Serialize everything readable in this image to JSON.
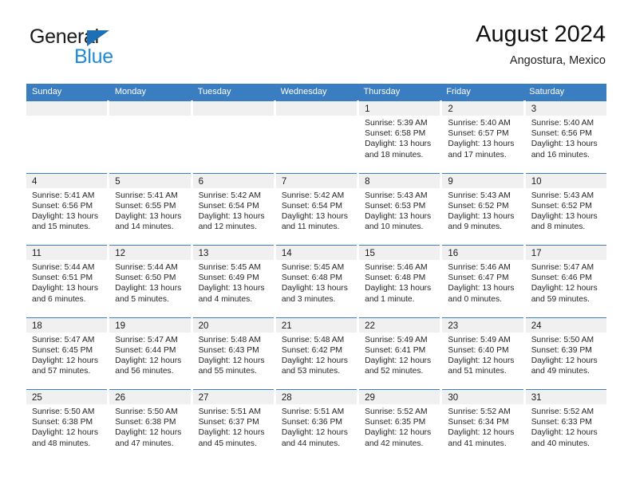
{
  "brand": {
    "name_part1": "General",
    "name_part2": "Blue",
    "triangle_color": "#1f6fb5",
    "blue_text_color": "#1f8ada"
  },
  "header": {
    "title": "August 2024",
    "subtitle": "Angostura, Mexico",
    "header_bg_color": "#3a7dc0",
    "daynum_band_color": "#f0f0f0"
  },
  "weekdays": [
    "Sunday",
    "Monday",
    "Tuesday",
    "Wednesday",
    "Thursday",
    "Friday",
    "Saturday"
  ],
  "labels": {
    "sunrise_prefix": "Sunrise:",
    "sunset_prefix": "Sunset:",
    "daylight_prefix": "Daylight:"
  },
  "weeks": [
    [
      {
        "empty": true
      },
      {
        "empty": true
      },
      {
        "empty": true
      },
      {
        "empty": true
      },
      {
        "day": "1",
        "sunrise": "Sunrise: 5:39 AM",
        "sunset": "Sunset: 6:58 PM",
        "daylight_line1": "Daylight: 13 hours",
        "daylight_line2": "and 18 minutes."
      },
      {
        "day": "2",
        "sunrise": "Sunrise: 5:40 AM",
        "sunset": "Sunset: 6:57 PM",
        "daylight_line1": "Daylight: 13 hours",
        "daylight_line2": "and 17 minutes."
      },
      {
        "day": "3",
        "sunrise": "Sunrise: 5:40 AM",
        "sunset": "Sunset: 6:56 PM",
        "daylight_line1": "Daylight: 13 hours",
        "daylight_line2": "and 16 minutes."
      }
    ],
    [
      {
        "day": "4",
        "sunrise": "Sunrise: 5:41 AM",
        "sunset": "Sunset: 6:56 PM",
        "daylight_line1": "Daylight: 13 hours",
        "daylight_line2": "and 15 minutes."
      },
      {
        "day": "5",
        "sunrise": "Sunrise: 5:41 AM",
        "sunset": "Sunset: 6:55 PM",
        "daylight_line1": "Daylight: 13 hours",
        "daylight_line2": "and 14 minutes."
      },
      {
        "day": "6",
        "sunrise": "Sunrise: 5:42 AM",
        "sunset": "Sunset: 6:54 PM",
        "daylight_line1": "Daylight: 13 hours",
        "daylight_line2": "and 12 minutes."
      },
      {
        "day": "7",
        "sunrise": "Sunrise: 5:42 AM",
        "sunset": "Sunset: 6:54 PM",
        "daylight_line1": "Daylight: 13 hours",
        "daylight_line2": "and 11 minutes."
      },
      {
        "day": "8",
        "sunrise": "Sunrise: 5:43 AM",
        "sunset": "Sunset: 6:53 PM",
        "daylight_line1": "Daylight: 13 hours",
        "daylight_line2": "and 10 minutes."
      },
      {
        "day": "9",
        "sunrise": "Sunrise: 5:43 AM",
        "sunset": "Sunset: 6:52 PM",
        "daylight_line1": "Daylight: 13 hours",
        "daylight_line2": "and 9 minutes."
      },
      {
        "day": "10",
        "sunrise": "Sunrise: 5:43 AM",
        "sunset": "Sunset: 6:52 PM",
        "daylight_line1": "Daylight: 13 hours",
        "daylight_line2": "and 8 minutes."
      }
    ],
    [
      {
        "day": "11",
        "sunrise": "Sunrise: 5:44 AM",
        "sunset": "Sunset: 6:51 PM",
        "daylight_line1": "Daylight: 13 hours",
        "daylight_line2": "and 6 minutes."
      },
      {
        "day": "12",
        "sunrise": "Sunrise: 5:44 AM",
        "sunset": "Sunset: 6:50 PM",
        "daylight_line1": "Daylight: 13 hours",
        "daylight_line2": "and 5 minutes."
      },
      {
        "day": "13",
        "sunrise": "Sunrise: 5:45 AM",
        "sunset": "Sunset: 6:49 PM",
        "daylight_line1": "Daylight: 13 hours",
        "daylight_line2": "and 4 minutes."
      },
      {
        "day": "14",
        "sunrise": "Sunrise: 5:45 AM",
        "sunset": "Sunset: 6:48 PM",
        "daylight_line1": "Daylight: 13 hours",
        "daylight_line2": "and 3 minutes."
      },
      {
        "day": "15",
        "sunrise": "Sunrise: 5:46 AM",
        "sunset": "Sunset: 6:48 PM",
        "daylight_line1": "Daylight: 13 hours",
        "daylight_line2": "and 1 minute."
      },
      {
        "day": "16",
        "sunrise": "Sunrise: 5:46 AM",
        "sunset": "Sunset: 6:47 PM",
        "daylight_line1": "Daylight: 13 hours",
        "daylight_line2": "and 0 minutes."
      },
      {
        "day": "17",
        "sunrise": "Sunrise: 5:47 AM",
        "sunset": "Sunset: 6:46 PM",
        "daylight_line1": "Daylight: 12 hours",
        "daylight_line2": "and 59 minutes."
      }
    ],
    [
      {
        "day": "18",
        "sunrise": "Sunrise: 5:47 AM",
        "sunset": "Sunset: 6:45 PM",
        "daylight_line1": "Daylight: 12 hours",
        "daylight_line2": "and 57 minutes."
      },
      {
        "day": "19",
        "sunrise": "Sunrise: 5:47 AM",
        "sunset": "Sunset: 6:44 PM",
        "daylight_line1": "Daylight: 12 hours",
        "daylight_line2": "and 56 minutes."
      },
      {
        "day": "20",
        "sunrise": "Sunrise: 5:48 AM",
        "sunset": "Sunset: 6:43 PM",
        "daylight_line1": "Daylight: 12 hours",
        "daylight_line2": "and 55 minutes."
      },
      {
        "day": "21",
        "sunrise": "Sunrise: 5:48 AM",
        "sunset": "Sunset: 6:42 PM",
        "daylight_line1": "Daylight: 12 hours",
        "daylight_line2": "and 53 minutes."
      },
      {
        "day": "22",
        "sunrise": "Sunrise: 5:49 AM",
        "sunset": "Sunset: 6:41 PM",
        "daylight_line1": "Daylight: 12 hours",
        "daylight_line2": "and 52 minutes."
      },
      {
        "day": "23",
        "sunrise": "Sunrise: 5:49 AM",
        "sunset": "Sunset: 6:40 PM",
        "daylight_line1": "Daylight: 12 hours",
        "daylight_line2": "and 51 minutes."
      },
      {
        "day": "24",
        "sunrise": "Sunrise: 5:50 AM",
        "sunset": "Sunset: 6:39 PM",
        "daylight_line1": "Daylight: 12 hours",
        "daylight_line2": "and 49 minutes."
      }
    ],
    [
      {
        "day": "25",
        "sunrise": "Sunrise: 5:50 AM",
        "sunset": "Sunset: 6:38 PM",
        "daylight_line1": "Daylight: 12 hours",
        "daylight_line2": "and 48 minutes."
      },
      {
        "day": "26",
        "sunrise": "Sunrise: 5:50 AM",
        "sunset": "Sunset: 6:38 PM",
        "daylight_line1": "Daylight: 12 hours",
        "daylight_line2": "and 47 minutes."
      },
      {
        "day": "27",
        "sunrise": "Sunrise: 5:51 AM",
        "sunset": "Sunset: 6:37 PM",
        "daylight_line1": "Daylight: 12 hours",
        "daylight_line2": "and 45 minutes."
      },
      {
        "day": "28",
        "sunrise": "Sunrise: 5:51 AM",
        "sunset": "Sunset: 6:36 PM",
        "daylight_line1": "Daylight: 12 hours",
        "daylight_line2": "and 44 minutes."
      },
      {
        "day": "29",
        "sunrise": "Sunrise: 5:52 AM",
        "sunset": "Sunset: 6:35 PM",
        "daylight_line1": "Daylight: 12 hours",
        "daylight_line2": "and 42 minutes."
      },
      {
        "day": "30",
        "sunrise": "Sunrise: 5:52 AM",
        "sunset": "Sunset: 6:34 PM",
        "daylight_line1": "Daylight: 12 hours",
        "daylight_line2": "and 41 minutes."
      },
      {
        "day": "31",
        "sunrise": "Sunrise: 5:52 AM",
        "sunset": "Sunset: 6:33 PM",
        "daylight_line1": "Daylight: 12 hours",
        "daylight_line2": "and 40 minutes."
      }
    ]
  ]
}
